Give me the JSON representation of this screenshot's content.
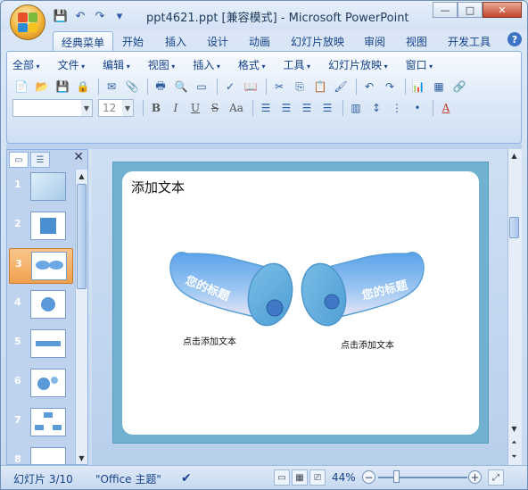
{
  "window": {
    "title": "ppt4621.ppt [兼容模式] - Microsoft PowerPoint",
    "controls": {
      "minimize": "—",
      "maximize": "□",
      "close": "✕"
    }
  },
  "quick_access": {
    "save": "💾",
    "undo": "↶",
    "redo": "↷",
    "customize": "▾"
  },
  "tabs": [
    {
      "label": "经典菜单",
      "active": true
    },
    {
      "label": "开始"
    },
    {
      "label": "插入"
    },
    {
      "label": "设计"
    },
    {
      "label": "动画"
    },
    {
      "label": "幻灯片放映"
    },
    {
      "label": "审阅"
    },
    {
      "label": "视图"
    },
    {
      "label": "开发工具"
    }
  ],
  "help_icon": "?",
  "menu": [
    "全部",
    "文件",
    "编辑",
    "视图",
    "插入",
    "格式",
    "工具",
    "幻灯片放映",
    "窗口"
  ],
  "toolbar": {
    "font_name_placeholder": "",
    "font_size": "12",
    "bold": "B",
    "italic": "I",
    "underline": "U",
    "strike": "S",
    "aa": "Aa",
    "font_color": "A"
  },
  "slides_panel": {
    "close": "✕",
    "items": [
      {
        "number": "1"
      },
      {
        "number": "2"
      },
      {
        "number": "3",
        "selected": true
      },
      {
        "number": "4"
      },
      {
        "number": "5"
      },
      {
        "number": "6"
      },
      {
        "number": "7"
      },
      {
        "number": "8"
      }
    ]
  },
  "slide": {
    "title": "添加文本",
    "shape_left_label": "您的标题",
    "shape_right_label": "您的标题",
    "caption_left": "点击添加文本",
    "caption_right": "点击添加文本"
  },
  "status": {
    "slide_counter": "幻灯片 3/10",
    "theme": "\"Office 主题\"",
    "zoom": "44%",
    "zoom_level": 0.44
  },
  "colors": {
    "accent": "#15428b",
    "slide_frame": "#6fb1cf",
    "selected_thumb": "#f1a14e"
  }
}
